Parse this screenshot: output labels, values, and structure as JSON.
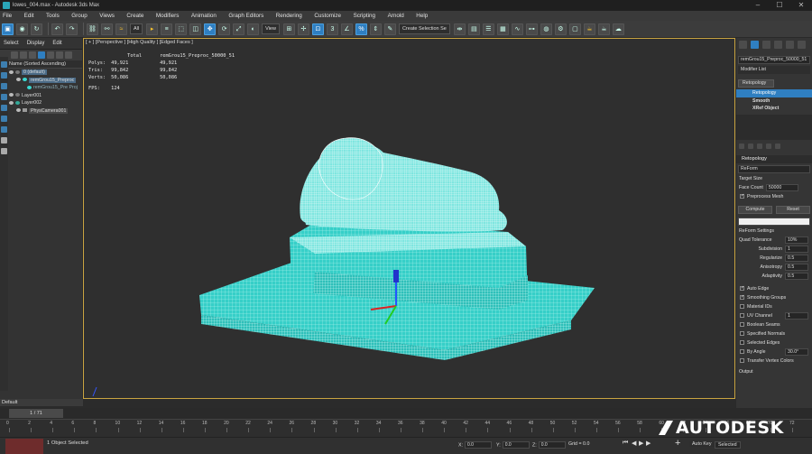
{
  "window": {
    "title": "lowes_004.max - Autodesk 3ds Max",
    "controls": [
      "–",
      "☐",
      "✕"
    ]
  },
  "menu": [
    "File",
    "Edit",
    "Tools",
    "Group",
    "Views",
    "Create",
    "Modifiers",
    "Animation",
    "Graph Editors",
    "Rendering",
    "Customize",
    "Scripting",
    "Arnold",
    "Help"
  ],
  "toolbar": {
    "filter": "All",
    "view_dropdown": "View",
    "selection_set": "Create Selection Se"
  },
  "scene_explorer": {
    "tabs": [
      "Select",
      "Display",
      "Edit"
    ],
    "header": "Name (Sorted Ascending)",
    "rows": [
      {
        "label": "0 (default)",
        "indent": 0,
        "selected": true
      },
      {
        "label": "remGrou15_Preproc",
        "indent": 1,
        "selected": true
      },
      {
        "label": "remGrou15_Pre Proj",
        "indent": 2,
        "selected": false,
        "dim": true
      },
      {
        "label": "Layer001",
        "indent": 0,
        "selected": false
      },
      {
        "label": "Layer002",
        "indent": 0,
        "selected": false
      },
      {
        "label": "PhysCamera001",
        "indent": 1,
        "selected": false
      }
    ]
  },
  "viewport": {
    "label": "[ + ] [Perspective ] [High Quality ] [Edged Faces ]",
    "stats": {
      "col_total": "Total",
      "col_object": "remGrou15_Preproc_50000_51",
      "rows": [
        {
          "label": "Polys:",
          "total": "49,921",
          "object": "49,921"
        },
        {
          "label": "Tris:",
          "total": "99,842",
          "object": "99,842"
        },
        {
          "label": "Verts:",
          "total": "50,086",
          "object": "50,086"
        }
      ],
      "fps_label": "FPS:",
      "fps": "124"
    }
  },
  "command_panel": {
    "object_name": "remGrou15_Preproc_50000_51",
    "modifier_list": "Modifier List",
    "stack": [
      {
        "label": "Retopology",
        "selected": false,
        "badge": true
      },
      {
        "label": "Retopology",
        "selected": true
      },
      {
        "label": "Smooth",
        "selected": false
      },
      {
        "label": "XRef Object",
        "selected": false
      }
    ],
    "rollout": "Retopology",
    "method": "ReForm",
    "target_size": "Target Size",
    "face_count_label": "Face Count",
    "face_count": "50000",
    "preprocess": "Preprocess Mesh",
    "compute": "Compute",
    "reset": "Reset",
    "reform_settings": "ReForm Settings",
    "params": [
      {
        "label": "Quad Tolerance",
        "value": "10%"
      },
      {
        "label": "Subdivision",
        "value": "1"
      },
      {
        "label": "Regularize",
        "value": "0.5"
      },
      {
        "label": "Anisotropy",
        "value": "0.5"
      },
      {
        "label": "Adaptivity",
        "value": "0.5"
      }
    ],
    "checks": [
      {
        "label": "Auto Edge",
        "checked": true
      },
      {
        "label": "Smoothing Groups",
        "checked": true
      },
      {
        "label": "Material IDs",
        "checked": false
      },
      {
        "label": "UV Channel",
        "checked": false,
        "value": "1"
      },
      {
        "label": "Boolean Seams",
        "checked": false
      },
      {
        "label": "Specified Normals",
        "checked": false
      },
      {
        "label": "Selected Edges",
        "checked": false
      },
      {
        "label": "By Angle",
        "checked": false,
        "value": "30.0°"
      },
      {
        "label": "Transfer Vertex Colors",
        "checked": false
      }
    ],
    "output": "Output"
  },
  "timeline": {
    "layer": "Default",
    "frame": "1 / 71",
    "ticks": [
      "0",
      "2",
      "4",
      "6",
      "8",
      "10",
      "12",
      "14",
      "16",
      "18",
      "20",
      "22",
      "24",
      "26",
      "28",
      "30",
      "32",
      "34",
      "36",
      "38",
      "40",
      "42",
      "44",
      "46",
      "48",
      "50",
      "52",
      "54",
      "56",
      "58",
      "60",
      "62",
      "64",
      "66",
      "68",
      "70",
      "72"
    ]
  },
  "status": {
    "selected": "1 Object Selected",
    "x_label": "X:",
    "x": "0.0",
    "y_label": "Y:",
    "y": "0.0",
    "z_label": "Z:",
    "z": "0.0",
    "grid_label": "Grid = 0.0",
    "auto_key": "Auto Key",
    "selected_dd": "Selected",
    "brand": "AUTODESK"
  },
  "colors": {
    "mesh": "#3ad8d0",
    "wire": "#e8fffd",
    "accent": "#2f7fc1",
    "viewport_border": "#c9a441"
  }
}
